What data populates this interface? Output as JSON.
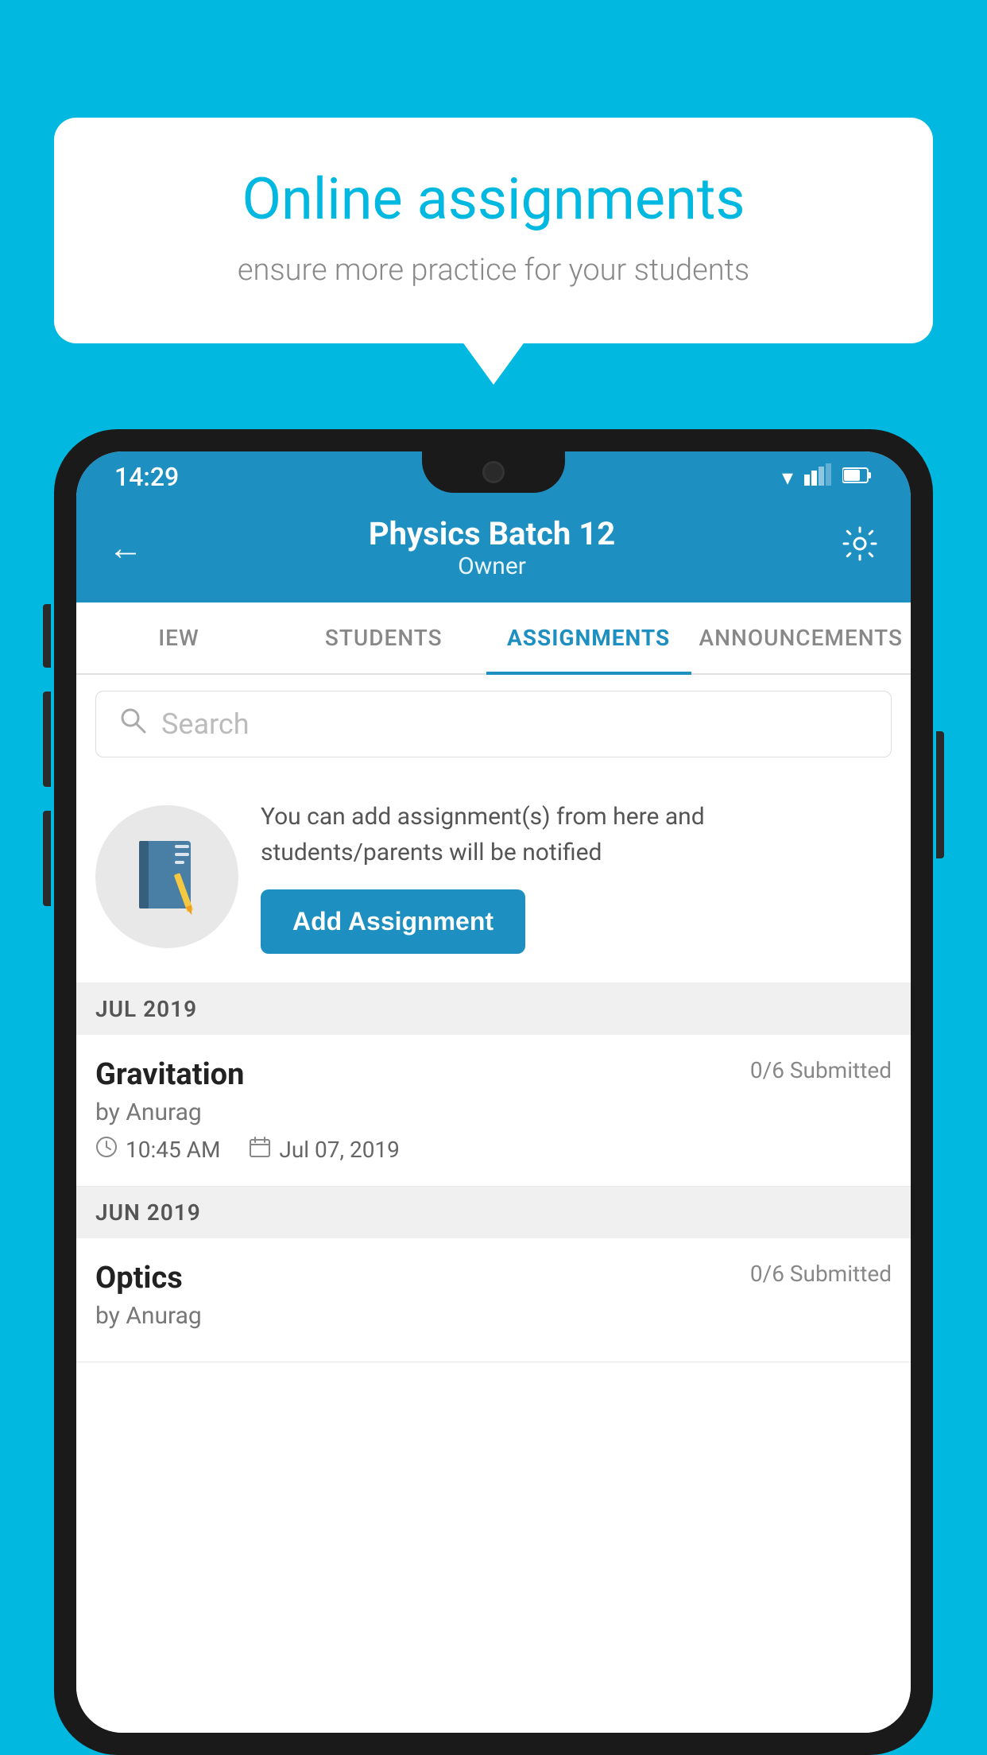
{
  "background_color": "#00b8e0",
  "speech_bubble": {
    "title": "Online assignments",
    "subtitle": "ensure more practice for your students"
  },
  "status_bar": {
    "time": "14:29",
    "wifi": "▼",
    "signal": "▲",
    "battery": "▌"
  },
  "header": {
    "title": "Physics Batch 12",
    "subtitle": "Owner",
    "back_label": "←",
    "settings_label": "⚙"
  },
  "tabs": [
    {
      "label": "IEW",
      "active": false
    },
    {
      "label": "STUDENTS",
      "active": false
    },
    {
      "label": "ASSIGNMENTS",
      "active": true
    },
    {
      "label": "ANNOUNCEMENTS",
      "active": false
    }
  ],
  "search": {
    "placeholder": "Search"
  },
  "promo": {
    "description": "You can add assignment(s) from here and students/parents will be notified",
    "button_label": "Add Assignment"
  },
  "sections": [
    {
      "month": "JUL 2019",
      "assignments": [
        {
          "name": "Gravitation",
          "submitted": "0/6 Submitted",
          "by": "by Anurag",
          "time": "10:45 AM",
          "date": "Jul 07, 2019"
        }
      ]
    },
    {
      "month": "JUN 2019",
      "assignments": [
        {
          "name": "Optics",
          "submitted": "0/6 Submitted",
          "by": "by Anurag",
          "time": "",
          "date": ""
        }
      ]
    }
  ]
}
